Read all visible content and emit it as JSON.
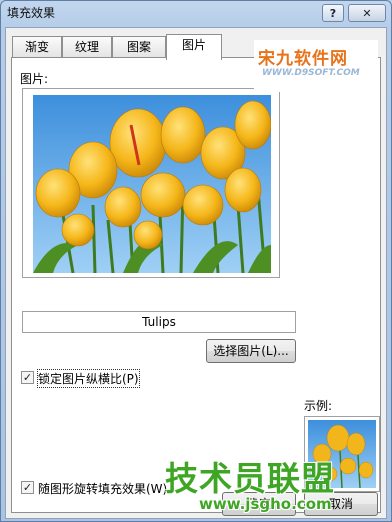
{
  "window": {
    "title": "填充效果",
    "help_glyph": "?",
    "close_glyph": "✕"
  },
  "tabs": [
    {
      "label": "渐变"
    },
    {
      "label": "纹理"
    },
    {
      "label": "图案"
    },
    {
      "label": "图片"
    }
  ],
  "active_tab": "图片",
  "picture_section": {
    "label": "图片:",
    "file_name": "Tulips",
    "select_button_label": "选择图片(L)..."
  },
  "options": {
    "lock_aspect": {
      "label": "锁定图片纵横比(P)",
      "checked": true
    },
    "rotate_with_shape": {
      "label": "随图形旋转填充效果(W)",
      "checked": true
    }
  },
  "preview": {
    "label": "示例:"
  },
  "footer": {
    "ok_label": "确定",
    "cancel_label": "取消"
  },
  "watermarks": {
    "top_brand": "宋九软件网",
    "top_url": "WWW.D9SOFT.COM",
    "bottom_brand": "技术员联盟",
    "bottom_url": "www.jsgho.com"
  },
  "colors": {
    "sky": "#5aa6e6",
    "tulip": "#f2b51c",
    "stem": "#3f7a1f",
    "watermark_green": "#3ea624",
    "watermark_orange": "#e8731a"
  }
}
